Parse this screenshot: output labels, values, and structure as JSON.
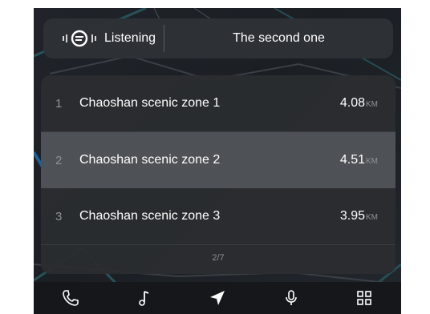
{
  "voice": {
    "status": "Listening",
    "query": "The second one"
  },
  "results": {
    "items": [
      {
        "index": "1",
        "name": "Chaoshan scenic zone 1",
        "distance": "4.08",
        "unit": "KM",
        "selected": false
      },
      {
        "index": "2",
        "name": "Chaoshan scenic zone 2",
        "distance": "4.51",
        "unit": "KM",
        "selected": true
      },
      {
        "index": "3",
        "name": "Chaoshan scenic zone 3",
        "distance": "3.95",
        "unit": "KM",
        "selected": false
      }
    ],
    "page": "2/7"
  },
  "navbar": {
    "items": [
      {
        "name": "phone-icon"
      },
      {
        "name": "music-icon"
      },
      {
        "name": "navigation-icon"
      },
      {
        "name": "microphone-icon"
      },
      {
        "name": "apps-grid-icon"
      }
    ]
  },
  "colors": {
    "background": "#1a1d22",
    "panel": "#2a2c30",
    "selected_row": "#4e5155",
    "text": "#ffffff",
    "muted_text": "#8f9399"
  }
}
